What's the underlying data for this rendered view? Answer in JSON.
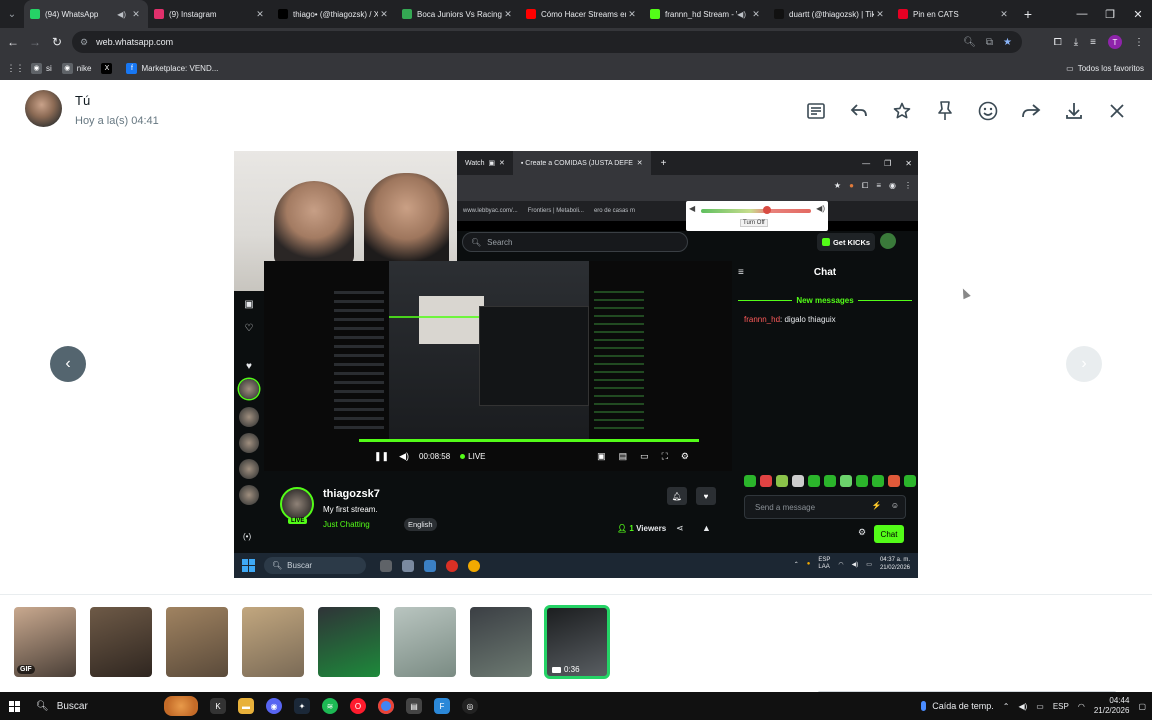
{
  "browser": {
    "tabs": [
      {
        "title": "(94) WhatsApp",
        "color": "#25d366",
        "active": true,
        "audio": true
      },
      {
        "title": "(9) Instagram",
        "color": "#e1306c",
        "active": false,
        "audio": false
      },
      {
        "title": "thiago• (@thiagozsk) / X",
        "color": "#000000",
        "active": false,
        "audio": false
      },
      {
        "title": "Boca Juniors Vs Racing Cl",
        "color": "#34a853",
        "active": false,
        "audio": false
      },
      {
        "title": "Cómo Hacer Streams en K",
        "color": "#ff0000",
        "active": false,
        "audio": false
      },
      {
        "title": "frannn_hd Stream - W",
        "color": "#53fc18",
        "active": false,
        "audio": true
      },
      {
        "title": "duartt (@thiagozsk) | TikT",
        "color": "#111111",
        "active": false,
        "audio": false
      },
      {
        "title": "Pin en CATS",
        "color": "#e60023",
        "active": false,
        "audio": false
      }
    ],
    "url": "web.whatsapp.com",
    "profile_initial": "T",
    "bookmarks": [
      {
        "label": "si",
        "color": "#5f6368"
      },
      {
        "label": "nike",
        "color": "#5f6368"
      },
      {
        "label": "",
        "color": "#000000"
      },
      {
        "label": "Marketplace: VEND...",
        "color": "#1877f2"
      }
    ],
    "all_bookmarks": "Todos los favoritos"
  },
  "viewer": {
    "sender": "Tú",
    "timestamp": "Hoy a la(s) 04:41",
    "actions": [
      "list-icon",
      "reply-icon",
      "star-icon",
      "pin-icon",
      "emoji-icon",
      "forward-icon",
      "download-icon",
      "close-icon"
    ]
  },
  "media": {
    "inner_tabs": [
      "Watch",
      "Create a COMIDAS (JUSTA DEFE"
    ],
    "inner_bookmarks": [
      "www.lebbyac.com/...",
      "Frontiers | Metaboli...",
      "ero de casas m"
    ],
    "volume_popup": {
      "turn_off": "Turn Off",
      "level": 0.6
    },
    "kick": {
      "search_placeholder": "Search",
      "get_kicks": "Get KICKs",
      "chat_title": "Chat",
      "new_messages": "New messages",
      "chat_user": "frannn_hd",
      "chat_text": ": digalo thiaguix",
      "send_placeholder": "Send a message",
      "chat_button": "Chat",
      "timecode": "00:08:58",
      "live_label": "LIVE",
      "streamer": "thiagozsk7",
      "stream_title": "My first stream.",
      "category": "Just Chatting",
      "language": "English",
      "live_badge": "LIVE",
      "viewers_count": "1",
      "viewers_label": "Viewers"
    },
    "inner_taskbar": {
      "search": "Buscar",
      "lang": "ESP",
      "lang2": "LAA",
      "time": "04:37 a. m.",
      "date": "21/02/2026"
    }
  },
  "thumbnails": [
    {
      "badge": "GIF",
      "selected": false,
      "colors": [
        "#c9a98f",
        "#4a3f37"
      ]
    },
    {
      "badge": "",
      "selected": false,
      "colors": [
        "#6e5a47",
        "#2f2620"
      ]
    },
    {
      "badge": "",
      "selected": false,
      "colors": [
        "#a08361",
        "#5a4a3a"
      ]
    },
    {
      "badge": "",
      "selected": false,
      "colors": [
        "#c2a77f",
        "#7a6a56"
      ]
    },
    {
      "badge": "",
      "selected": false,
      "colors": [
        "#2f3338",
        "#1d8a3a"
      ]
    },
    {
      "badge": "",
      "selected": false,
      "colors": [
        "#b9c5c0",
        "#7a8b83"
      ]
    },
    {
      "badge": "",
      "selected": false,
      "colors": [
        "#3b3f44",
        "#6d7a72"
      ]
    },
    {
      "badge": "",
      "selected": true,
      "duration": "0:36",
      "colors": [
        "#1b1d1f",
        "#5a5f63"
      ]
    }
  ],
  "taskbar": {
    "search": "Buscar",
    "weather": "Caída de temp.",
    "lang": "ESP",
    "time": "04:44",
    "date": "21/2/2026"
  }
}
